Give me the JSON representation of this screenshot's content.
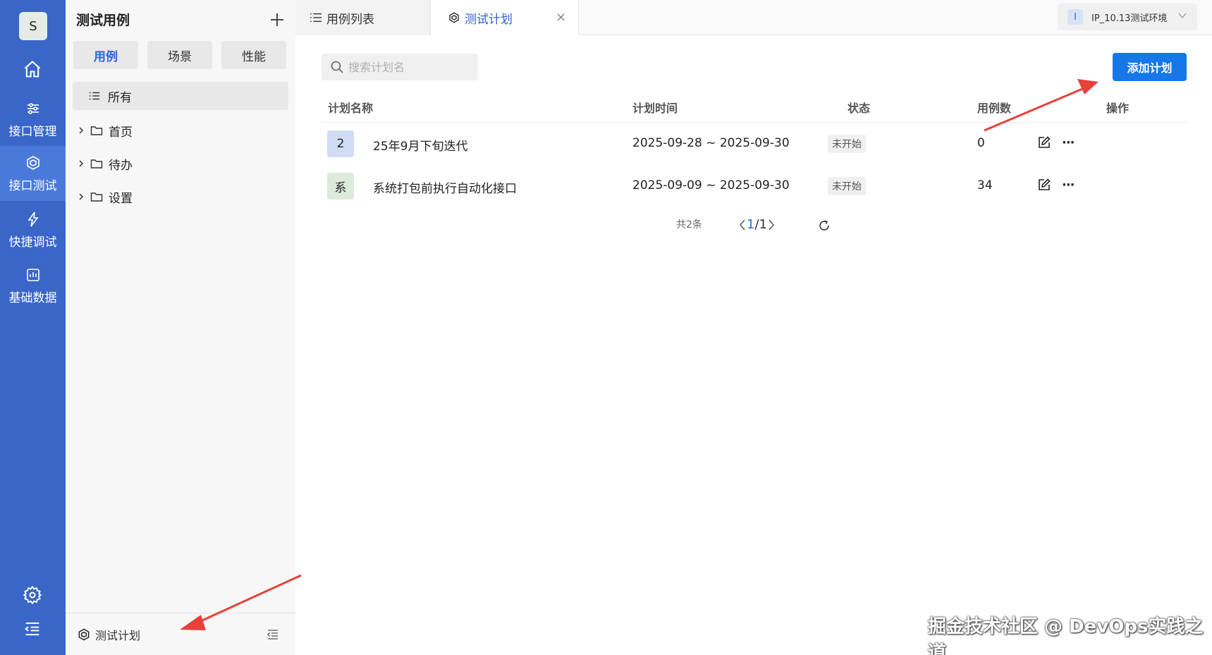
{
  "rail": {
    "avatar": "S",
    "items": [
      {
        "label": "接口管理"
      },
      {
        "label": "接口测试"
      },
      {
        "label": "快捷调试"
      },
      {
        "label": "基础数据"
      }
    ]
  },
  "tree": {
    "title": "测试用例",
    "segments": [
      "用例",
      "场景",
      "性能"
    ],
    "all_label": "所有",
    "folders": [
      "首页",
      "待办",
      "设置"
    ],
    "footer_label": "测试计划"
  },
  "tabs": {
    "list_label": "用例列表",
    "plan_label": "测试计划",
    "close": "×"
  },
  "env": {
    "badge": "I",
    "label": "IP_10.13测试环境"
  },
  "search": {
    "placeholder": "搜索计划名"
  },
  "add_button": "添加计划",
  "table": {
    "headers": [
      "计划名称",
      "计划时间",
      "状态",
      "用例数",
      "操作"
    ],
    "rows": [
      {
        "badge": "2",
        "badge_color": "#cfdcf3",
        "name": "25年9月下旬迭代",
        "time": "2025-09-28 ~ 2025-09-30",
        "status": "未开始",
        "count": "0"
      },
      {
        "badge": "系",
        "badge_color": "#dcebdc",
        "name": "系统打包前执行自动化接口",
        "time": "2025-09-09 ~ 2025-09-30",
        "status": "未开始",
        "count": "34"
      }
    ]
  },
  "pager": {
    "total": "共2条",
    "current": "1",
    "pages": "1"
  },
  "watermark": "掘金技术社区 @ DevOps实践之道",
  "colors": {
    "rail": "#3a66c8",
    "accent": "#1677e8",
    "arrow": "#e8403a"
  }
}
